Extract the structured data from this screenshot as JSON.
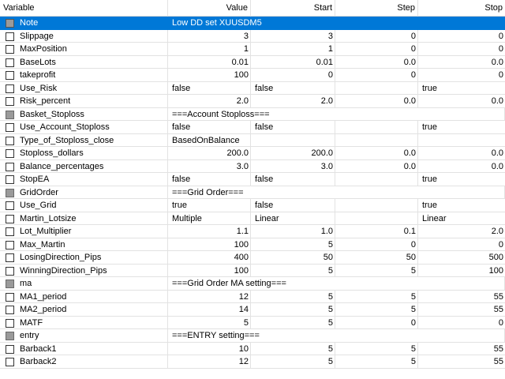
{
  "headers": [
    "Variable",
    "Value",
    "Start",
    "Step",
    "Stop"
  ],
  "rows": [
    {
      "name": "Note",
      "value": "Low DD set  XUUSDM5",
      "checkbox": "grey",
      "selected": true,
      "header": true
    },
    {
      "name": "Slippage",
      "value": "3",
      "start": "3",
      "step": "0",
      "stop": "0"
    },
    {
      "name": "MaxPosition",
      "value": "1",
      "start": "1",
      "step": "0",
      "stop": "0"
    },
    {
      "name": "BaseLots",
      "value": "0.01",
      "start": "0.01",
      "step": "0.0",
      "stop": "0.0"
    },
    {
      "name": "takeprofit",
      "value": "100",
      "start": "0",
      "step": "0",
      "stop": "0"
    },
    {
      "name": "Use_Risk",
      "value": "false",
      "start": "false",
      "step": "",
      "stop": "true",
      "text": true
    },
    {
      "name": "Risk_percent",
      "value": "2.0",
      "start": "2.0",
      "step": "0.0",
      "stop": "0.0"
    },
    {
      "name": "Basket_Stoploss",
      "value": "===Account Stoploss===",
      "checkbox": "grey",
      "header": true
    },
    {
      "name": "Use_Account_Stoploss",
      "value": "false",
      "start": "false",
      "step": "",
      "stop": "true",
      "text": true
    },
    {
      "name": "Type_of_Stoploss_close",
      "value": "BasedOnBalance",
      "start": "",
      "step": "",
      "stop": "",
      "text": true
    },
    {
      "name": "Stoploss_dollars",
      "value": "200.0",
      "start": "200.0",
      "step": "0.0",
      "stop": "0.0"
    },
    {
      "name": "Balance_percentages",
      "value": "3.0",
      "start": "3.0",
      "step": "0.0",
      "stop": "0.0"
    },
    {
      "name": "StopEA",
      "value": "false",
      "start": "false",
      "step": "",
      "stop": "true",
      "text": true
    },
    {
      "name": "GridOrder",
      "value": "===Grid Order===",
      "checkbox": "grey",
      "header": true
    },
    {
      "name": "Use_Grid",
      "value": "true",
      "start": "false",
      "step": "",
      "stop": "true",
      "text": true
    },
    {
      "name": "Martin_Lotsize",
      "value": "Multiple",
      "start": "Linear",
      "step": "",
      "stop": "Linear",
      "text": true
    },
    {
      "name": "Lot_Multiplier",
      "value": "1.1",
      "start": "1.0",
      "step": "0.1",
      "stop": "2.0"
    },
    {
      "name": "Max_Martin",
      "value": "100",
      "start": "5",
      "step": "0",
      "stop": "0"
    },
    {
      "name": "LosingDirection_Pips",
      "value": "400",
      "start": "50",
      "step": "50",
      "stop": "500"
    },
    {
      "name": "WinningDirection_Pips",
      "value": "100",
      "start": "5",
      "step": "5",
      "stop": "100"
    },
    {
      "name": "ma",
      "value": "===Grid Order MA setting===",
      "checkbox": "grey",
      "header": true
    },
    {
      "name": "MA1_period",
      "value": "12",
      "start": "5",
      "step": "5",
      "stop": "55"
    },
    {
      "name": "MA2_period",
      "value": "14",
      "start": "5",
      "step": "5",
      "stop": "55"
    },
    {
      "name": "MATF",
      "value": "5",
      "start": "5",
      "step": "0",
      "stop": "0"
    },
    {
      "name": "entry",
      "value": "===ENTRY setting===",
      "checkbox": "grey",
      "header": true
    },
    {
      "name": "Barback1",
      "value": "10",
      "start": "5",
      "step": "5",
      "stop": "55"
    },
    {
      "name": "Barback2",
      "value": "12",
      "start": "5",
      "step": "5",
      "stop": "55"
    }
  ],
  "colors": {
    "selection": "#0078d7",
    "grid_line": "#e2e2e2"
  }
}
